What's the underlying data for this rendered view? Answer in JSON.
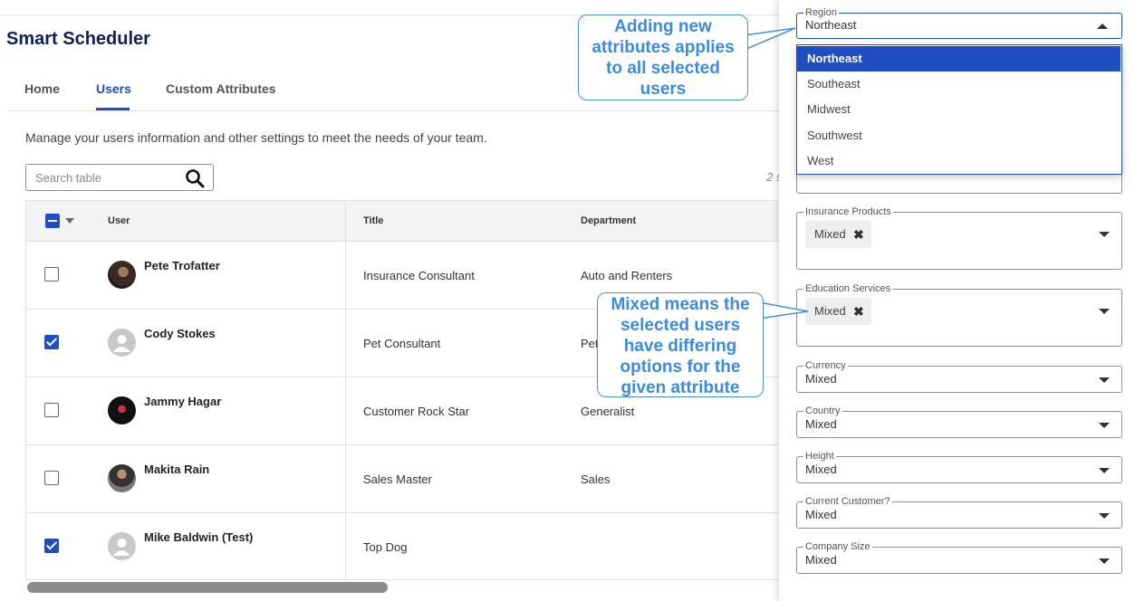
{
  "app": {
    "title": "Smart Scheduler",
    "tabs": [
      {
        "label": "Home",
        "active": false
      },
      {
        "label": "Users",
        "active": true
      },
      {
        "label": "Custom Attributes",
        "active": false
      }
    ],
    "intro": "Manage your users information and other settings to meet the needs of your team.",
    "search_placeholder": "Search table",
    "selected_count": "2 s"
  },
  "table": {
    "headers": {
      "user": "User",
      "title": "Title",
      "department": "Department"
    },
    "rows": [
      {
        "name": "Pete Trofatter",
        "title": "Insurance Consultant",
        "department": "Auto and Renters",
        "checked": false
      },
      {
        "name": "Cody Stokes",
        "title": "Pet Consultant",
        "department": "Pet",
        "checked": true
      },
      {
        "name": "Jammy Hagar",
        "title": "Customer Rock Star",
        "department": "Generalist",
        "checked": false
      },
      {
        "name": "Makita Rain",
        "title": "Sales Master",
        "department": "Sales",
        "checked": false
      },
      {
        "name": "Mike Baldwin (Test)",
        "title": "Top Dog",
        "department": "",
        "checked": true
      }
    ]
  },
  "panel": {
    "region": {
      "label": "Region",
      "value": "Northeast",
      "options": [
        "Northeast",
        "Southeast",
        "Midwest",
        "Southwest",
        "West"
      ]
    },
    "insurance": {
      "label": "Insurance Products",
      "chip": "Mixed"
    },
    "education": {
      "label": "Education Services",
      "chip": "Mixed"
    },
    "currency": {
      "label": "Currency",
      "value": "Mixed"
    },
    "country": {
      "label": "Country",
      "value": "Mixed"
    },
    "height": {
      "label": "Height",
      "value": "Mixed"
    },
    "customer": {
      "label": "Current Customer?",
      "value": "Mixed"
    },
    "company": {
      "label": "Company Size",
      "value": "Mixed"
    }
  },
  "callouts": {
    "one": [
      "Adding new",
      "attributes applies",
      "to all selected",
      "users"
    ],
    "two": [
      "Mixed means the",
      "selected users",
      "have differing",
      "options for the",
      "given attribute"
    ]
  },
  "colors": {
    "accent": "#1f4ec2",
    "callout": "#3a8be0",
    "title": "#0f1f5c"
  }
}
